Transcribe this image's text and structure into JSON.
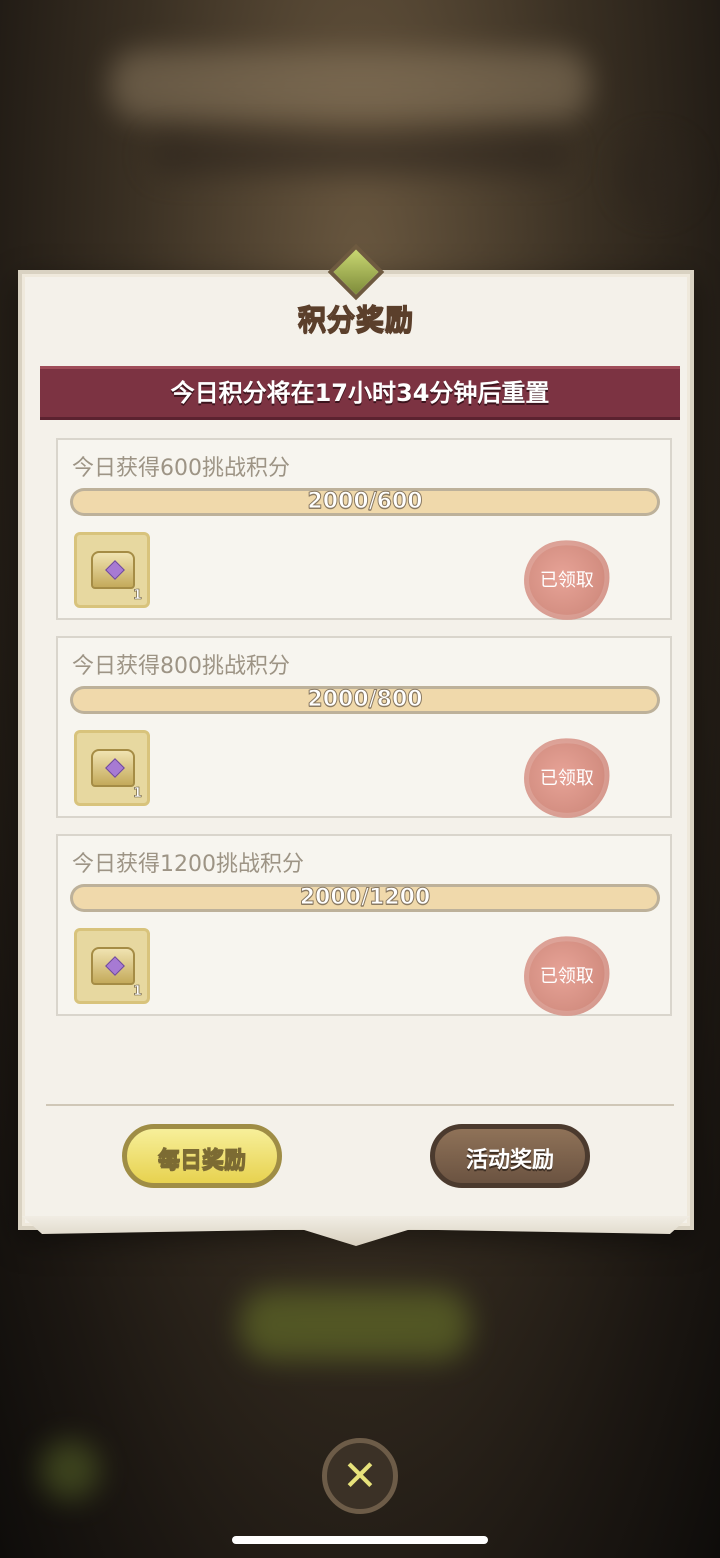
{
  "panel": {
    "title": "积分奖励",
    "reset_notice": "今日积分将在17小时34分钟后重置"
  },
  "tasks": [
    {
      "title": "今日获得600挑战积分",
      "progress": "2000/600",
      "progress_fraction": 1.0,
      "reward_count": "1",
      "status": "已领取"
    },
    {
      "title": "今日获得800挑战积分",
      "progress": "2000/800",
      "progress_fraction": 1.0,
      "reward_count": "1",
      "status": "已领取"
    },
    {
      "title": "今日获得1200挑战积分",
      "progress": "2000/1200",
      "progress_fraction": 1.0,
      "reward_count": "1",
      "status": "已领取"
    }
  ],
  "tabs": {
    "daily": "每日奖励",
    "event": "活动奖励"
  },
  "icons": {
    "close": "close-icon",
    "reward": "treasure-chest-icon",
    "seal": "wax-seal-icon"
  },
  "colors": {
    "banner": "#7c3342",
    "progress_fill": "#f0d9ab",
    "seal": "#d48f82",
    "tab_active": "#e7d24f",
    "tab_inactive": "#6b5341"
  }
}
